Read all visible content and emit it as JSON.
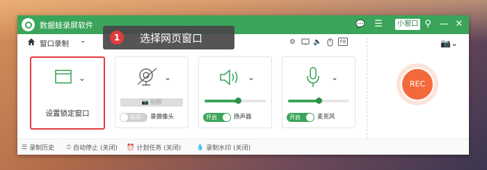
{
  "app": {
    "title": "数据蛙录屏软件",
    "mini_window_label": "小窗口"
  },
  "titlebar": {
    "buttons": [
      {
        "name": "message-icon",
        "glyph": "💬"
      },
      {
        "name": "menu-icon",
        "glyph": "☰"
      },
      {
        "name": "pin-icon",
        "glyph": "⚲"
      },
      {
        "name": "minimize-icon",
        "glyph": "—"
      },
      {
        "name": "close-icon",
        "glyph": "✕"
      }
    ]
  },
  "toolbar": {
    "mode_label": "窗口录制",
    "chevron": "⌄"
  },
  "cards": {
    "window": {
      "label": "设置锁定窗口",
      "chevron": "⌄"
    },
    "webcam": {
      "snapshot_label": "拍照",
      "toggle_label": "关闭",
      "device_label": "录摄像头",
      "state": "off"
    },
    "speaker": {
      "toggle_label": "开启",
      "device_label": "扬声器",
      "volume": 0.55,
      "state": "on"
    },
    "microphone": {
      "toggle_label": "开启",
      "device_label": "麦克风",
      "volume": 0.5,
      "state": "on"
    }
  },
  "rec": {
    "label": "REC"
  },
  "statusbar": {
    "items": [
      {
        "icon": "list-icon",
        "glyph": "☰",
        "label": "录制历史"
      },
      {
        "icon": "clock-icon",
        "glyph": "⏱",
        "label": "自动停止 (关闭)"
      },
      {
        "icon": "alarm-icon",
        "glyph": "⏰",
        "label": "计划任务 (关闭)"
      },
      {
        "icon": "droplet-icon",
        "glyph": "💧",
        "label": "录制水印 (关闭)"
      }
    ]
  },
  "tooltip": {
    "number": "1",
    "text": "选择网页窗口"
  }
}
